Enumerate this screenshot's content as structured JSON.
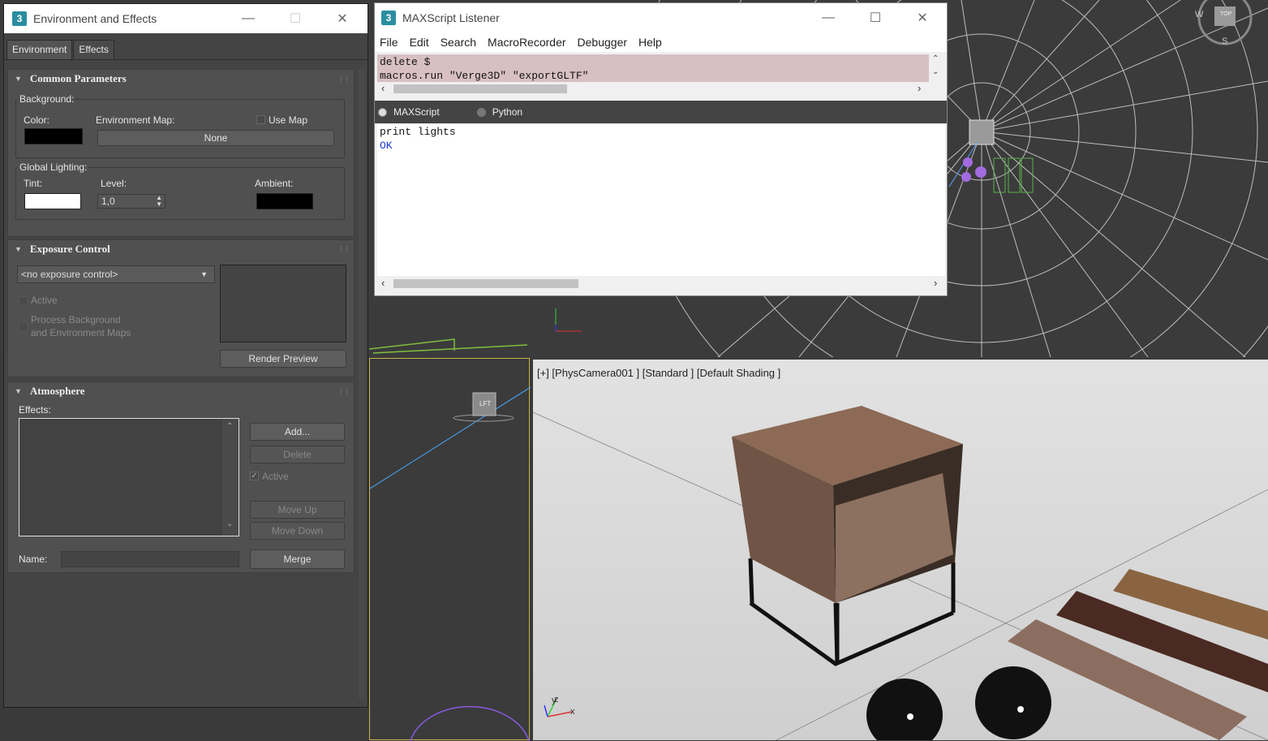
{
  "env_window": {
    "title": "Environment and Effects",
    "tabs": [
      "Environment",
      "Effects"
    ],
    "common": {
      "title": "Common Parameters",
      "background_label": "Background:",
      "color_label": "Color:",
      "env_map_label": "Environment Map:",
      "use_map_label": "Use Map",
      "map_button": "None",
      "global_lighting_label": "Global Lighting:",
      "tint_label": "Tint:",
      "level_label": "Level:",
      "level_value": "1,0",
      "ambient_label": "Ambient:"
    },
    "exposure": {
      "title": "Exposure Control",
      "dropdown_value": "<no exposure control>",
      "active_label": "Active",
      "process_line1": "Process Background",
      "process_line2": "and Environment Maps",
      "render_preview": "Render Preview"
    },
    "atmosphere": {
      "title": "Atmosphere",
      "effects_label": "Effects:",
      "add": "Add...",
      "delete": "Delete",
      "active_label": "Active",
      "move_up": "Move Up",
      "move_down": "Move Down",
      "name_label": "Name:",
      "merge": "Merge"
    }
  },
  "listener": {
    "title": "MAXScript Listener",
    "menu": [
      "File",
      "Edit",
      "Search",
      "MacroRecorder",
      "Debugger",
      "Help"
    ],
    "macro_lines": [
      "delete $",
      "macros.run \"Verge3D\" \"exportGLTF\""
    ],
    "lang_maxscript": "MAXScript",
    "lang_python": "Python",
    "output_lines": [
      "print lights",
      "OK"
    ]
  },
  "viewport": {
    "camera_label": "[+] [PhysCamera001 ] [Standard ] [Default Shading ]",
    "viewcube_left": "LFT",
    "viewcube_top": "TOP",
    "compass": [
      "W",
      "S"
    ],
    "axes": [
      "x",
      "y",
      "z"
    ]
  },
  "colors": {
    "accent_highlight": "#d8c0c2",
    "viewport_border": "#c8b24a",
    "ok_text": "#1a3cd0"
  }
}
